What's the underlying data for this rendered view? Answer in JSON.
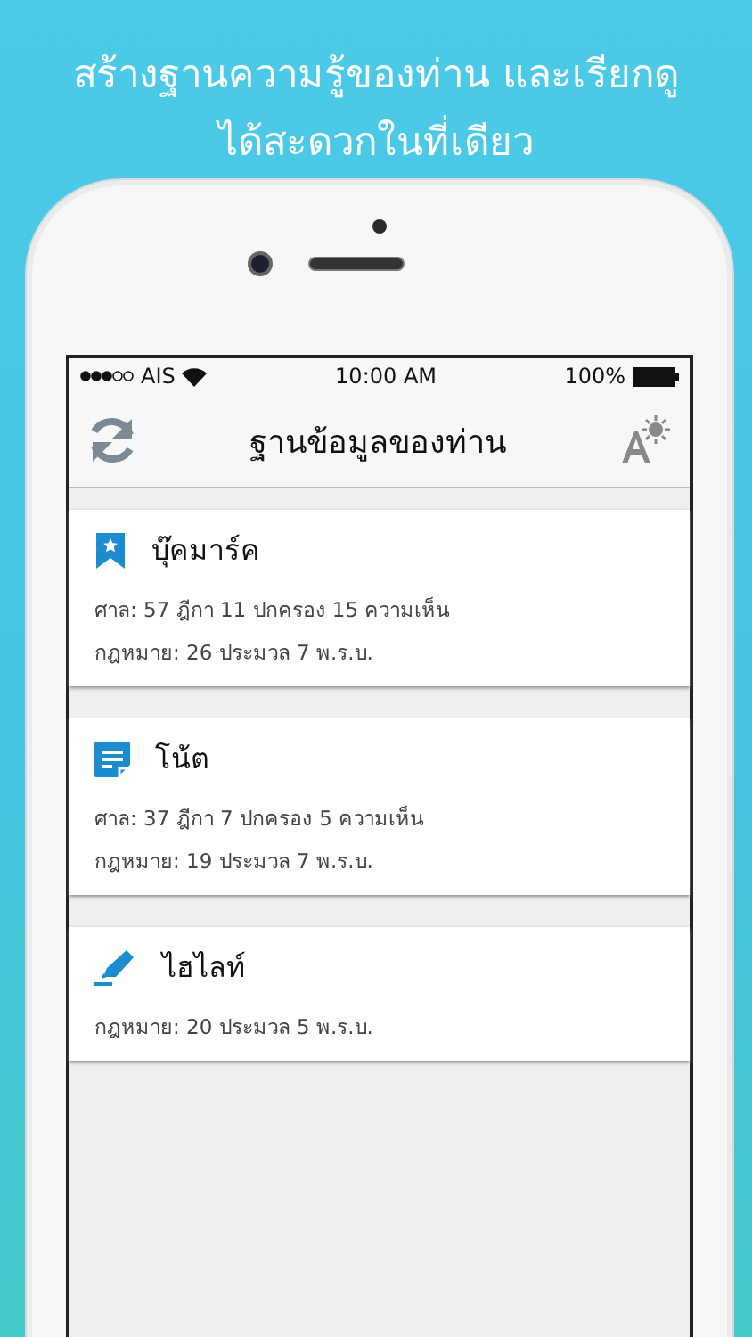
{
  "headline": "สร้างฐานความรู้ของท่าน และเรียกดู ได้สะดวกในที่เดียว",
  "status_bar": {
    "carrier": "AIS",
    "time": "10:00 AM",
    "battery": "100%"
  },
  "nav_bar": {
    "title": "ฐานข้อมูลของท่าน"
  },
  "cards": [
    {
      "kind": "bookmark",
      "title": "บุ๊คมาร์ค",
      "lines": [
        "ศาล: 57 ฎีกา 11 ปกครอง 15 ความเห็น",
        "กฎหมาย: 26 ประมวล 7 พ.ร.บ."
      ]
    },
    {
      "kind": "note",
      "title": "โน้ต",
      "lines": [
        "ศาล: 37 ฎีกา 7 ปกครอง 5 ความเห็น",
        "กฎหมาย: 19 ประมวล 7 พ.ร.บ."
      ]
    },
    {
      "kind": "highlight",
      "title": "ไฮไลท์",
      "lines": [
        "กฎหมาย: 20 ประมวล 5 พ.ร.บ."
      ]
    }
  ]
}
